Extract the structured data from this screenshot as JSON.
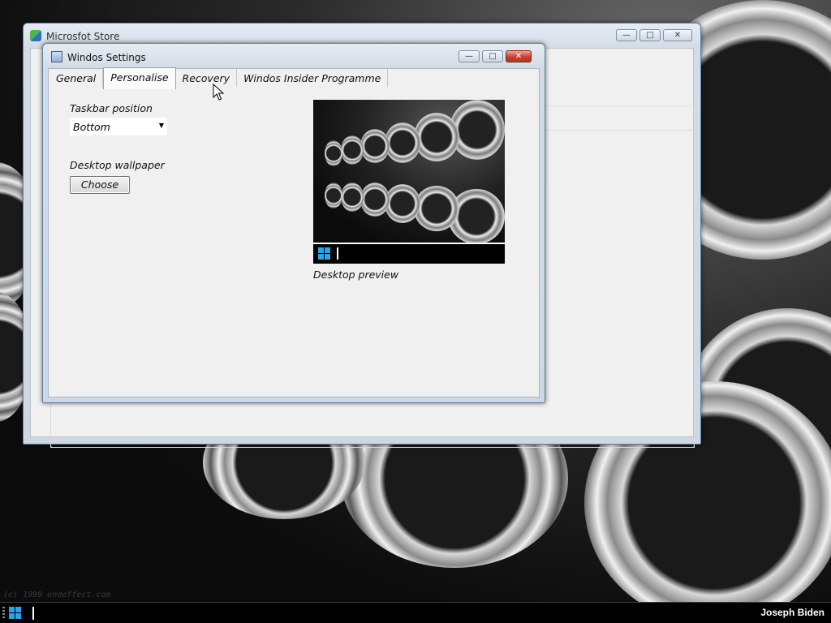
{
  "desktop": {
    "watermark": "(c) 1999 endeffect.com"
  },
  "store_window": {
    "title": "Microsfot Store"
  },
  "settings_window": {
    "title": "Windos Settings",
    "tabs": [
      {
        "label": "General",
        "active": false
      },
      {
        "label": "Personalise",
        "active": true
      },
      {
        "label": "Recovery",
        "active": false
      },
      {
        "label": "Windos Insider Programme",
        "active": false
      }
    ],
    "taskbar_position": {
      "label": "Taskbar position",
      "selected": "Bottom"
    },
    "wallpaper": {
      "label": "Desktop wallpaper",
      "button_label": "Choose"
    },
    "preview_caption": "Desktop preview"
  },
  "taskbar": {
    "user_name": "Joseph Biden"
  },
  "colors": {
    "accent_blue": "#2da3e6",
    "close_red": "#c2432e",
    "taskbar_bg": "#000000"
  }
}
